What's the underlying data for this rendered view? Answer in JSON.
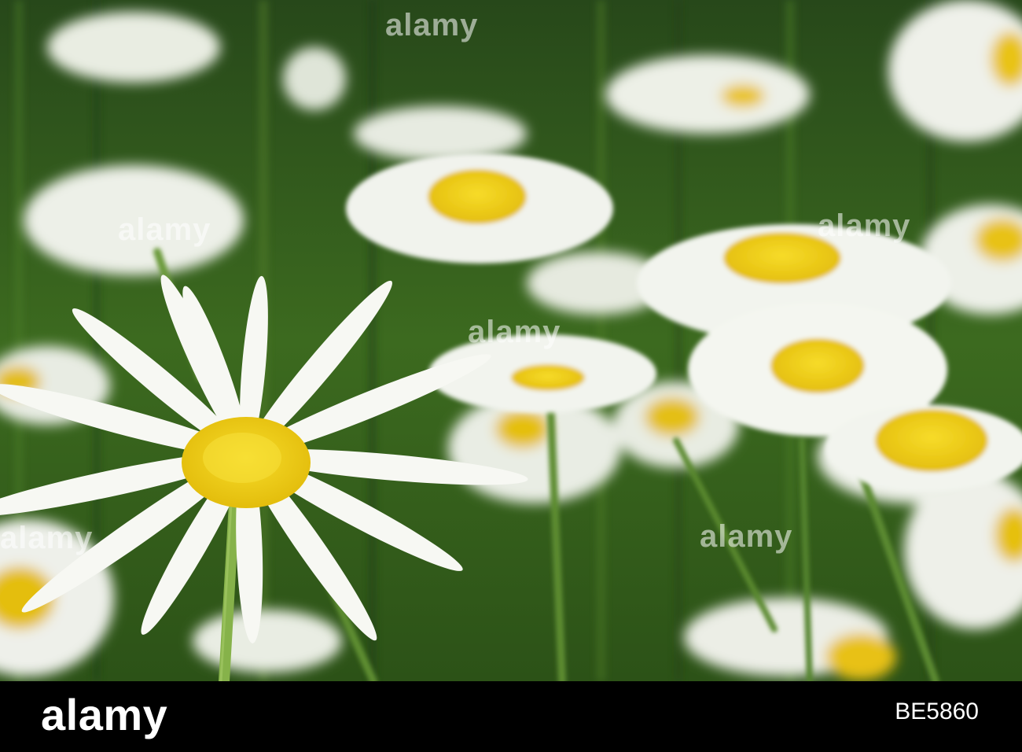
{
  "watermark": {
    "text": "alamy"
  },
  "footer": {
    "brand": "alamy",
    "image_code": "BE5860"
  },
  "colors": {
    "background_green": "#2f5a18",
    "petal_white": "#f6f7f2",
    "center_yellow": "#f2cf12",
    "footer_black": "#000000"
  }
}
